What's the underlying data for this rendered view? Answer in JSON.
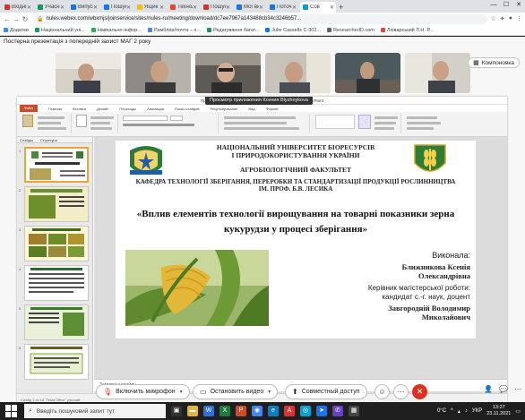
{
  "browser": {
    "tabs": [
      {
        "label": "Вхідні (3)",
        "color": "#d93025",
        "active": false
      },
      {
        "label": "Учасник",
        "color": "#0f9d58",
        "active": false
      },
      {
        "label": "Випуск",
        "color": "#1a73e8",
        "active": false
      },
      {
        "label": "Пошук ж",
        "color": "#1a73e8",
        "active": false
      },
      {
        "label": "Ящик",
        "color": "#fbbc04",
        "active": false
      },
      {
        "label": "Технолог",
        "color": "#ea4335",
        "active": false
      },
      {
        "label": "Пошук",
        "color": "#d93025",
        "active": false
      },
      {
        "label": "Мої ви",
        "color": "#1a73e8",
        "active": false
      },
      {
        "label": "Поточ",
        "color": "#1a73e8",
        "active": false
      },
      {
        "label": "Сов",
        "color": "#00a0d1",
        "active": true
      }
    ],
    "new_tab": "+",
    "url": "nules.webex.com/wbxmjs/joinservice/sites/nules-ru/meeting/download/dc7ee7967a143488cb34c3246b57...",
    "bookmarks": [
      {
        "label": "Додатки",
        "color": "#4285f4"
      },
      {
        "label": "Національний уні...",
        "color": "#0f9d58"
      },
      {
        "label": "Навчально-інфор...",
        "color": "#34a853"
      },
      {
        "label": "Рамблер/почта – н...",
        "color": "#4285f4"
      },
      {
        "label": "Редагування багат...",
        "color": "#0f9d58"
      },
      {
        "label": "Julie Cassells C-302...",
        "color": "#1a73e8"
      },
      {
        "label": "ResearcherID.com",
        "color": "#5f6368"
      },
      {
        "label": "Люварський Л.Н. Р...",
        "color": "#ea4335"
      }
    ]
  },
  "webex": {
    "sharer_text": "Постерна презентація з попередній захист МАГ 2 року",
    "layout_button": "Компоновка",
    "viewer_label": "Просмотр приложения Ксения Blyzhnykova",
    "ppt_window_title": "Презентація МАГІСТР Ближникова Ксенія — Microsoft PowerPoint",
    "ribbon_tabs": [
      "Файл",
      "Главная",
      "Вставка",
      "Дизайн",
      "Переходы",
      "Анимация",
      "Показ слайдов",
      "Рецензирование",
      "Вид",
      "Формат"
    ],
    "left_pane_tabs": [
      "Слайды",
      "Структура"
    ],
    "notes_placeholder": "Заметки к слайду",
    "status_text": "Слайд 1 из 18    \"Тема Office\"    русский",
    "slide_numbers": [
      "1",
      "2",
      "3",
      "4",
      "5",
      "6"
    ],
    "controls": {
      "mic": "Включить микрофон",
      "video": "Остановить видео",
      "share": "Совместный доступ",
      "end": "✕"
    }
  },
  "slide": {
    "univ_line1": "НАЦІОНАЛЬНИЙ УНІВЕРСИТЕТ БІОРЕСУРСІВ",
    "univ_line2": "І ПРИРОДОКОРИСТУВАННЯ УКРАЇНИ",
    "faculty": "АГРОБІОЛОГІЧНИЙ ФАКУЛЬТЕТ",
    "dept_line1": "КАФЕДРА ТЕХНОЛОГІЇ ЗБЕРІГАННЯ, ПЕРЕРОБКИ ТА СТАНДАРТИЗАЦІЇ ПРОДУКЦІЇ РОСЛИННИЦТВА",
    "dept_line2": "ІМ. ПРОФ. Б.В. ЛЕСИКА",
    "title": "«Вплив елементів технології вирощування на товарні показники зерна кукурудзи у процесі зберігання»",
    "performed_label": "Виконала:",
    "author_line1": "Ближникова Ксенія",
    "author_line2": "Олександрівна",
    "supervisor_label": "Керівник магістерської роботи:",
    "supervisor_degree": "кандидат с.-г. наук, доцент",
    "supervisor_line1": "Завгородній Володимир",
    "supervisor_line2": "Миколайович"
  },
  "taskbar": {
    "search_placeholder": "Введіть пошуковий запит тут",
    "weather": "0°C",
    "lang": "УКР",
    "time": "13:27",
    "date": "23.11.2021"
  }
}
